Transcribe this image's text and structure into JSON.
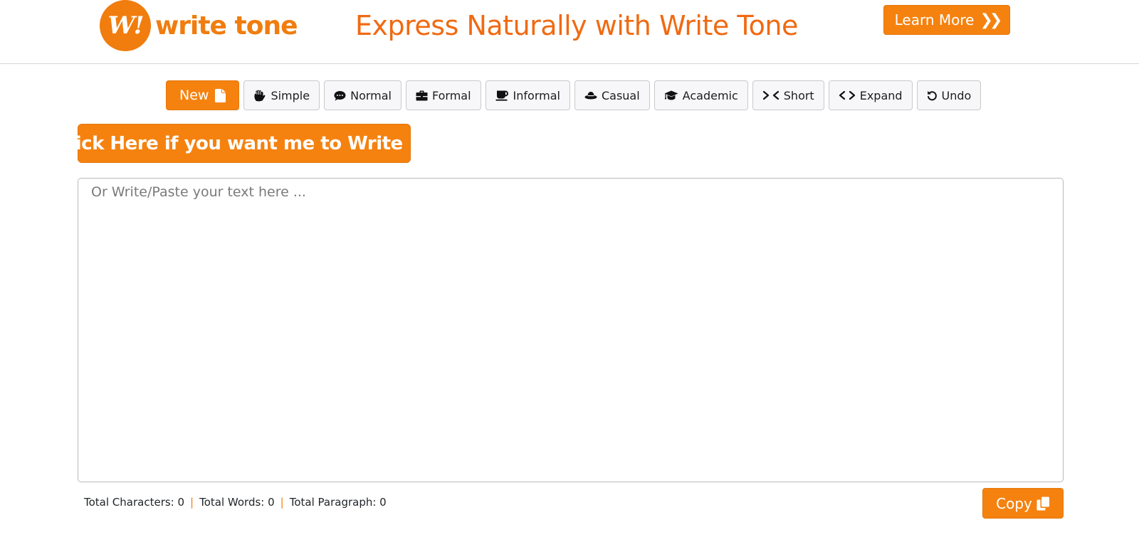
{
  "header": {
    "logo_mark": "W!",
    "logo_text": "write tone",
    "tagline": "Express Naturally with Write Tone",
    "learn_more_label": "Learn More"
  },
  "toolbar": {
    "items": [
      {
        "label": "New",
        "icon": "file-icon"
      },
      {
        "label": "Simple",
        "icon": "hand-icon"
      },
      {
        "label": "Normal",
        "icon": "comment-icon"
      },
      {
        "label": "Formal",
        "icon": "briefcase-icon"
      },
      {
        "label": "Informal",
        "icon": "mug-icon"
      },
      {
        "label": "Casual",
        "icon": "hat-icon"
      },
      {
        "label": "Academic",
        "icon": "graduation-cap-icon"
      },
      {
        "label": "Short",
        "icon": "compress-icon"
      },
      {
        "label": "Expand",
        "icon": "code-icon"
      },
      {
        "label": "Undo",
        "icon": "undo-icon"
      }
    ]
  },
  "write_button_label": "Click Here if you want me to Write",
  "editor": {
    "value": "",
    "placeholder": "Or Write/Paste your text here ..."
  },
  "stats": {
    "characters_label": "Total Characters: 0",
    "words_label": "Total Words: 0",
    "paragraph_label": "Total Paragraph: 0",
    "separator": "|"
  },
  "copy_label": "Copy",
  "colors": {
    "accent": "#f5820f",
    "tagline": "#f06a12",
    "toolbar_bg": "#f7f6f9"
  }
}
